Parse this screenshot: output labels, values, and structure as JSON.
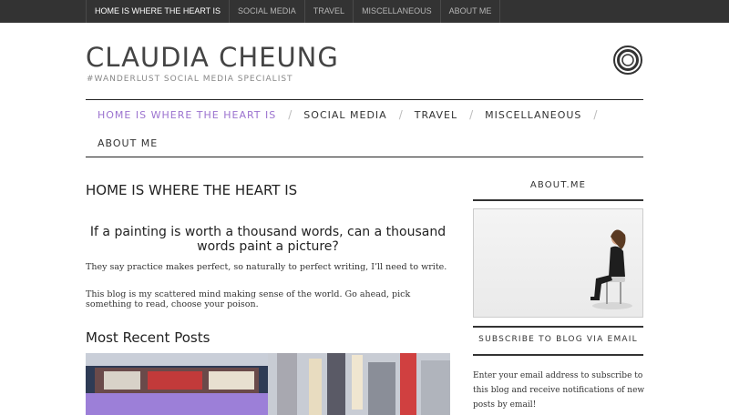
{
  "top_nav": {
    "items": [
      {
        "label": "HOME IS WHERE THE HEART IS",
        "active": true
      },
      {
        "label": "SOCIAL MEDIA",
        "active": false
      },
      {
        "label": "TRAVEL",
        "active": false
      },
      {
        "label": "MISCELLANEOUS",
        "active": false
      },
      {
        "label": "ABOUT ME",
        "active": false
      }
    ]
  },
  "header": {
    "site_title": "CLAUDIA CHEUNG",
    "tagline": "#WANDERLUST SOCIAL MEDIA SPECIALIST",
    "icon": "target-logo-icon"
  },
  "main_nav": {
    "items": [
      {
        "label": "HOME IS WHERE THE HEART IS",
        "active": true
      },
      {
        "label": "SOCIAL MEDIA",
        "active": false
      },
      {
        "label": "TRAVEL",
        "active": false
      },
      {
        "label": "MISCELLANEOUS",
        "active": false
      },
      {
        "label": "ABOUT ME",
        "active": false
      }
    ],
    "separator": "/"
  },
  "content": {
    "page_title": "HOME IS WHERE THE HEART IS",
    "intro_heading": "If a painting is worth a thousand words, can a thousand words paint a picture?",
    "paragraph_1": "They say practice makes perfect, so naturally to perfect writing, I’ll need to write.",
    "paragraph_2": "This blog is my scattered mind making sense of the world. Go ahead, pick something to read, choose your poison.",
    "recent_heading": "Most Recent Posts"
  },
  "sidebar": {
    "about_title": "ABOUT.ME",
    "subscribe_title": "SUBSCRIBE TO BLOG VIA EMAIL",
    "subscribe_text": "Enter your email address to subscribe to this blog and receive notifications of new posts by email!"
  },
  "colors": {
    "topbar_bg": "#333333",
    "accent": "#9b72cf",
    "text": "#222222"
  }
}
